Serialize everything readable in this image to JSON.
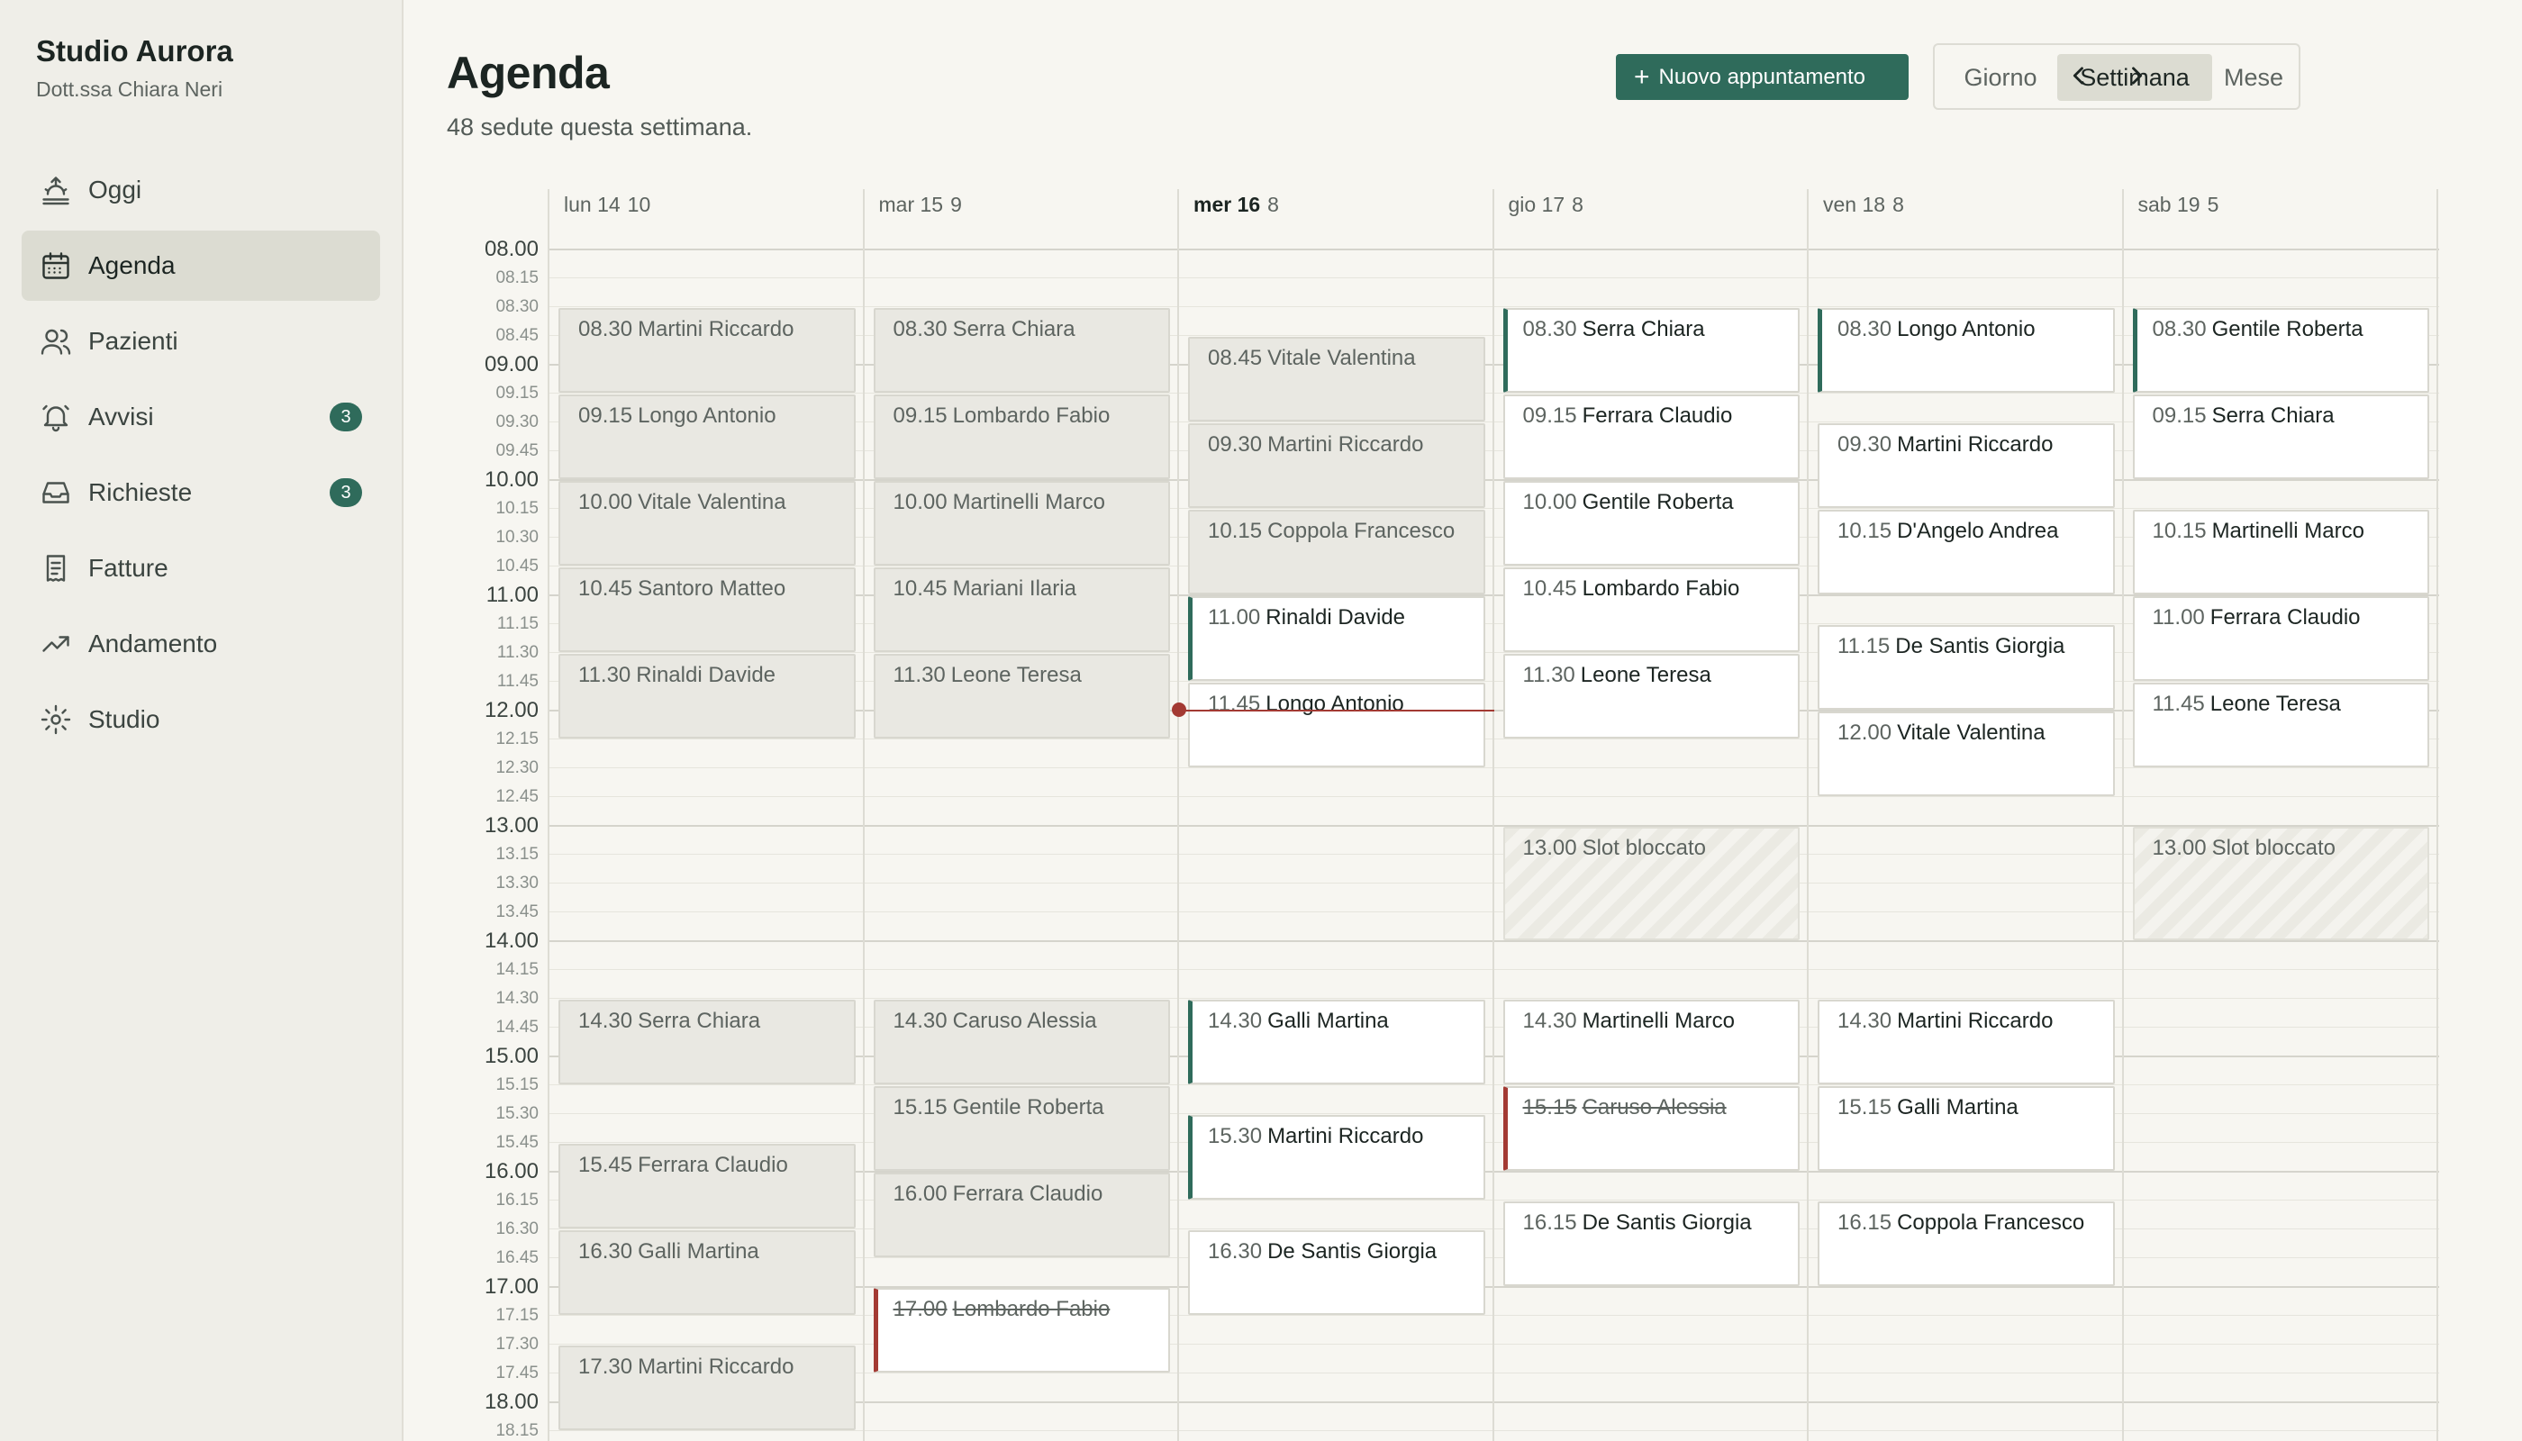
{
  "sidebar": {
    "brand": "Studio Aurora",
    "owner": "Dott.ssa Chiara Neri",
    "items": [
      {
        "label": "Oggi",
        "icon": "sunrise-icon"
      },
      {
        "label": "Agenda",
        "icon": "calendar-icon",
        "active": true
      },
      {
        "label": "Pazienti",
        "icon": "users-icon"
      },
      {
        "label": "Avvisi",
        "icon": "bell-icon",
        "badge": "3"
      },
      {
        "label": "Richieste",
        "icon": "inbox-icon",
        "badge": "3"
      },
      {
        "label": "Fatture",
        "icon": "invoice-icon"
      },
      {
        "label": "Andamento",
        "icon": "trend-icon"
      },
      {
        "label": "Studio",
        "icon": "gear-icon"
      }
    ]
  },
  "header": {
    "title": "Agenda",
    "subtitle": "48 sedute questa settimana.",
    "new_button": "Nuovo appuntamento",
    "views": [
      "Giorno",
      "Settimana",
      "Mese"
    ],
    "selected_view": "Settimana"
  },
  "colors": {
    "accent": "#2f6b5b",
    "cancelled": "#a33a33",
    "past_bg": "#e9e8e2",
    "now_line": "#a33a33"
  },
  "calendar": {
    "times": [
      "08.00",
      "08.15",
      "08.30",
      "08.45",
      "09.00",
      "09.15",
      "09.30",
      "09.45",
      "10.00",
      "10.15",
      "10.30",
      "10.45",
      "11.00",
      "11.15",
      "11.30",
      "11.45",
      "12.00",
      "12.15",
      "12.30",
      "12.45",
      "13.00",
      "13.15",
      "13.30",
      "13.45",
      "14.00",
      "14.15",
      "14.30",
      "14.45",
      "15.00",
      "15.15",
      "15.30",
      "15.45",
      "16.00",
      "16.15",
      "16.30",
      "16.45",
      "17.00",
      "17.15",
      "17.30",
      "17.45",
      "18.00",
      "18.15"
    ],
    "now": "12.00",
    "days": [
      {
        "label": "lun 14",
        "count": "10",
        "appointments": [
          {
            "time": "08.30",
            "name": "Martini Riccardo",
            "status": "past"
          },
          {
            "time": "09.15",
            "name": "Longo Antonio",
            "status": "past"
          },
          {
            "time": "10.00",
            "name": "Vitale Valentina",
            "status": "past"
          },
          {
            "time": "10.45",
            "name": "Santoro Matteo",
            "status": "past"
          },
          {
            "time": "11.30",
            "name": "Rinaldi Davide",
            "status": "past"
          },
          {
            "time": "14.30",
            "name": "Serra Chiara",
            "status": "past"
          },
          {
            "time": "15.45",
            "name": "Ferrara Claudio",
            "status": "past"
          },
          {
            "time": "16.30",
            "name": "Galli Martina",
            "status": "past"
          },
          {
            "time": "17.30",
            "name": "Martini Riccardo",
            "status": "past"
          }
        ]
      },
      {
        "label": "mar 15",
        "count": "9",
        "appointments": [
          {
            "time": "08.30",
            "name": "Serra Chiara",
            "status": "past"
          },
          {
            "time": "09.15",
            "name": "Lombardo Fabio",
            "status": "past"
          },
          {
            "time": "10.00",
            "name": "Martinelli Marco",
            "status": "past"
          },
          {
            "time": "10.45",
            "name": "Mariani Ilaria",
            "status": "past"
          },
          {
            "time": "11.30",
            "name": "Leone Teresa",
            "status": "past"
          },
          {
            "time": "14.30",
            "name": "Caruso Alessia",
            "status": "past"
          },
          {
            "time": "15.15",
            "name": "Gentile Roberta",
            "status": "past"
          },
          {
            "time": "16.00",
            "name": "Ferrara Claudio",
            "status": "past"
          },
          {
            "time": "17.00",
            "name": "Lombardo Fabio",
            "status": "cancelled"
          }
        ]
      },
      {
        "label": "mer 16",
        "count": "8",
        "today": true,
        "appointments": [
          {
            "time": "08.45",
            "name": "Vitale Valentina",
            "status": "past"
          },
          {
            "time": "09.30",
            "name": "Martini Riccardo",
            "status": "past"
          },
          {
            "time": "10.15",
            "name": "Coppola Francesco",
            "status": "past"
          },
          {
            "time": "11.00",
            "name": "Rinaldi Davide",
            "status": "confirmed"
          },
          {
            "time": "11.45",
            "name": "Longo Antonio",
            "status": "scheduled"
          },
          {
            "time": "14.30",
            "name": "Galli Martina",
            "status": "confirmed"
          },
          {
            "time": "15.30",
            "name": "Martini Riccardo",
            "status": "confirmed"
          },
          {
            "time": "16.30",
            "name": "De Santis Giorgia",
            "status": "scheduled"
          }
        ]
      },
      {
        "label": "gio 17",
        "count": "8",
        "appointments": [
          {
            "time": "08.30",
            "name": "Serra Chiara",
            "status": "confirmed"
          },
          {
            "time": "09.15",
            "name": "Ferrara Claudio",
            "status": "scheduled"
          },
          {
            "time": "10.00",
            "name": "Gentile Roberta",
            "status": "scheduled"
          },
          {
            "time": "10.45",
            "name": "Lombardo Fabio",
            "status": "scheduled"
          },
          {
            "time": "11.30",
            "name": "Leone Teresa",
            "status": "scheduled"
          },
          {
            "time": "13.00",
            "name": "Slot bloccato",
            "status": "blocked"
          },
          {
            "time": "14.30",
            "name": "Martinelli Marco",
            "status": "scheduled"
          },
          {
            "time": "15.15",
            "name": "Caruso Alessia",
            "status": "cancelled"
          },
          {
            "time": "16.15",
            "name": "De Santis Giorgia",
            "status": "scheduled"
          }
        ]
      },
      {
        "label": "ven 18",
        "count": "8",
        "appointments": [
          {
            "time": "08.30",
            "name": "Longo Antonio",
            "status": "confirmed"
          },
          {
            "time": "09.30",
            "name": "Martini Riccardo",
            "status": "scheduled"
          },
          {
            "time": "10.15",
            "name": "D'Angelo Andrea",
            "status": "scheduled"
          },
          {
            "time": "11.15",
            "name": "De Santis Giorgia",
            "status": "scheduled"
          },
          {
            "time": "12.00",
            "name": "Vitale Valentina",
            "status": "scheduled"
          },
          {
            "time": "14.30",
            "name": "Martini Riccardo",
            "status": "scheduled"
          },
          {
            "time": "15.15",
            "name": "Galli Martina",
            "status": "scheduled"
          },
          {
            "time": "16.15",
            "name": "Coppola Francesco",
            "status": "scheduled"
          }
        ]
      },
      {
        "label": "sab 19",
        "count": "5",
        "appointments": [
          {
            "time": "08.30",
            "name": "Gentile Roberta",
            "status": "confirmed"
          },
          {
            "time": "09.15",
            "name": "Serra Chiara",
            "status": "scheduled"
          },
          {
            "time": "10.15",
            "name": "Martinelli Marco",
            "status": "scheduled"
          },
          {
            "time": "11.00",
            "name": "Ferrara Claudio",
            "status": "scheduled"
          },
          {
            "time": "11.45",
            "name": "Leone Teresa",
            "status": "scheduled"
          },
          {
            "time": "13.00",
            "name": "Slot bloccato",
            "status": "blocked"
          }
        ]
      }
    ]
  }
}
